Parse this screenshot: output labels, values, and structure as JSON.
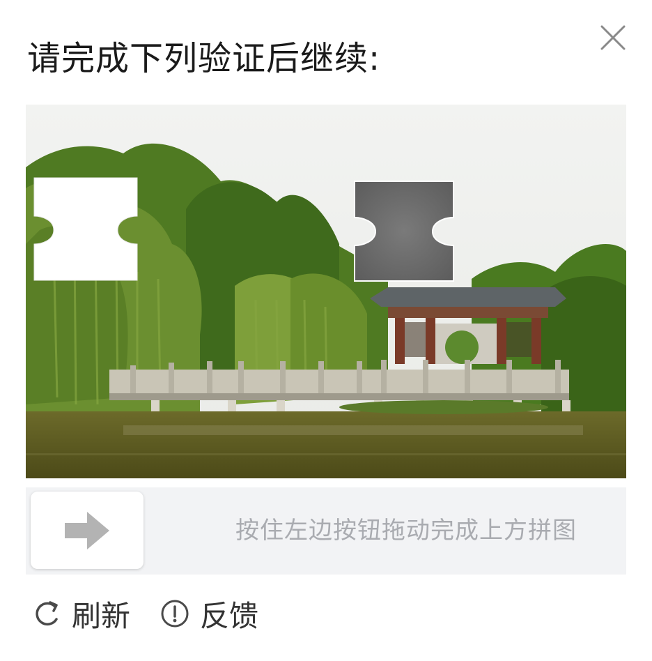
{
  "dialog": {
    "title": "请完成下列验证后继续:",
    "close_icon": "close-icon"
  },
  "captcha": {
    "type": "slider-puzzle",
    "scene": "chinese-pavilion-by-pond",
    "slider_hint": "按住左边按钮拖动完成上方拼图",
    "handle_icon": "arrow-right-icon",
    "piece_fill_color": "#ffffff",
    "target_hole_color": "#6e6e6e"
  },
  "footer": {
    "refresh_label": "刷新",
    "refresh_icon": "refresh-icon",
    "feedback_label": "反馈",
    "feedback_icon": "alert-circle-icon"
  },
  "colors": {
    "track_background": "#f2f3f5",
    "hint_text": "#a9abb0",
    "handle_arrow": "#b3b3b3"
  }
}
